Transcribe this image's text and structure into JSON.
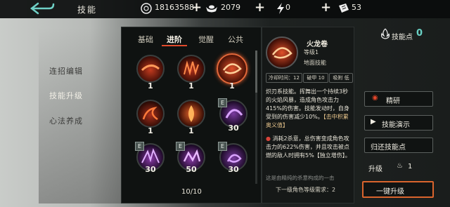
{
  "header": {
    "title": "技能",
    "coins": "18163588",
    "silver": "2079",
    "energy": "0",
    "tickets": "53"
  },
  "sidebar": {
    "items": [
      {
        "label": "连招编辑"
      },
      {
        "label": "技能升级"
      },
      {
        "label": "心法养成"
      }
    ]
  },
  "tabs": [
    "基础",
    "进阶",
    "觉醒",
    "公共"
  ],
  "skills": [
    {
      "level": "1",
      "e": false
    },
    {
      "level": "1",
      "e": false
    },
    {
      "level": "1",
      "e": false
    },
    {
      "level": "1",
      "e": false
    },
    {
      "level": "1",
      "e": false
    },
    {
      "level": "30",
      "e": true
    },
    {
      "level": "30",
      "e": true
    },
    {
      "level": "50",
      "e": true
    },
    {
      "level": "30",
      "e": true
    }
  ],
  "e_badge": "E",
  "pager": "10/10",
  "detail": {
    "name": "火龙卷",
    "level": "等级1",
    "type": "地面技能",
    "chips": [
      "冷却时间：12",
      "破甲 10",
      "吸附 低"
    ],
    "desc": "炽刃系技能。挥舞出一个持续3秒的火焰风暴，造成角色攻击力415%的伤害。技能发动时，自身受到的伤害减少10%。",
    "desc_hl": "【击中积累奥义值】",
    "desc2": "消耗2杀意，总伤害变成角色攻击力的622%伤害，并且攻击被点燃的敌人时拥有5%【独立增伤】。",
    "desc3": "这是由精纯的杀意构成的一击",
    "requirement": "下一级角色等级需求：2"
  },
  "right": {
    "skill_points_label": "技能点",
    "skill_points": "0",
    "buttons": [
      "精研",
      "技能演示",
      "归还技能点"
    ],
    "upgrade_label": "升级",
    "upgrade_cost": "1",
    "one_click": "一键升级"
  },
  "colors": {
    "accent": "#e24a2c",
    "skill_points": "#6ad2c5",
    "highlight": "#e7c48b"
  }
}
